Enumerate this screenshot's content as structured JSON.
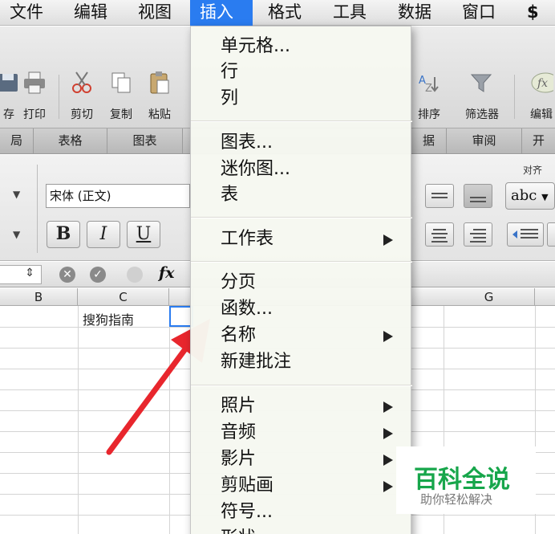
{
  "menubar": {
    "items": [
      "文件",
      "编辑",
      "视图",
      "插入",
      "格式",
      "工具",
      "数据",
      "窗口"
    ],
    "active": "插入"
  },
  "toolbar": {
    "buttons": [
      "存",
      "打印",
      "剪切",
      "复制",
      "粘贴",
      "排序",
      "筛选器",
      "编辑"
    ]
  },
  "tabs": [
    "局",
    "表格",
    "图表",
    "据",
    "审阅",
    "开"
  ],
  "format": {
    "font_name": "宋体 (正文)",
    "bold": "B",
    "italic": "I",
    "underline": "U",
    "align_label": "对齐",
    "abc": "abc",
    "fx": "fx"
  },
  "grid": {
    "columns": [
      "B",
      "C",
      "G"
    ],
    "cell_c1": "搜狗指南"
  },
  "dropdown": {
    "items": [
      {
        "label": "单元格...",
        "submenu": false
      },
      {
        "label": "行",
        "submenu": false
      },
      {
        "label": "列",
        "submenu": false
      },
      {
        "label": "图表...",
        "submenu": false
      },
      {
        "label": "迷你图...",
        "submenu": false
      },
      {
        "label": "表",
        "submenu": false
      },
      {
        "label": "工作表",
        "submenu": true
      },
      {
        "label": "分页",
        "submenu": false
      },
      {
        "label": "函数...",
        "submenu": false
      },
      {
        "label": "名称",
        "submenu": true
      },
      {
        "label": "新建批注",
        "submenu": false
      },
      {
        "label": "照片",
        "submenu": true
      },
      {
        "label": "音频",
        "submenu": true
      },
      {
        "label": "影片",
        "submenu": true
      },
      {
        "label": "剪贴画",
        "submenu": true
      },
      {
        "label": "符号...",
        "submenu": false
      },
      {
        "label": "形状",
        "submenu": false
      }
    ]
  },
  "watermark": {
    "title": "百科全说",
    "subtitle": "助你轻松解决"
  },
  "colors": {
    "accent": "#2a7cf0",
    "arrow": "#e8262d",
    "watermark_green": "#17a64b"
  }
}
